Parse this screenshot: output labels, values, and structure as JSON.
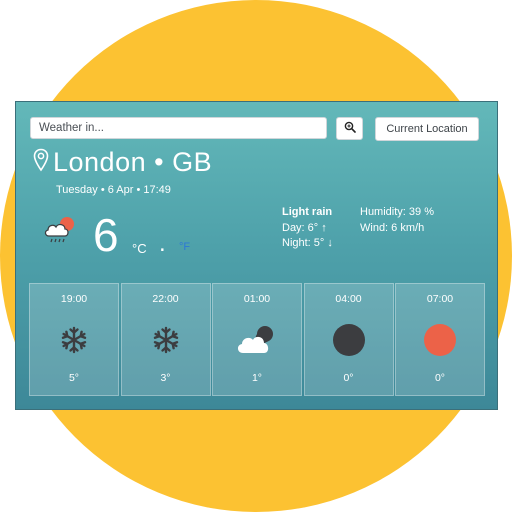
{
  "search": {
    "placeholder": "Weather in..."
  },
  "buttons": {
    "search_icon": "search-icon",
    "current_location": "Current Location"
  },
  "location": {
    "city": "London",
    "separator": "•",
    "country": "GB"
  },
  "date": "Tuesday • 6 Apr • 17:49",
  "current": {
    "temperature": "6",
    "unit_c": "°C",
    "unit_dot": ".",
    "unit_f": "°F",
    "icon": "cloud-sun-rain-icon",
    "description": "Light rain",
    "day": "Day: 6° ↑",
    "night": "Night: 5° ↓",
    "humidity": "Humidity: 39 %",
    "wind": "Wind: 6 km/h"
  },
  "forecast": [
    {
      "time": "19:00",
      "temp": "5°",
      "icon": "snowflake-icon"
    },
    {
      "time": "22:00",
      "temp": "3°",
      "icon": "snowflake-icon"
    },
    {
      "time": "01:00",
      "temp": "1°",
      "icon": "cloud-moon-icon"
    },
    {
      "time": "04:00",
      "temp": "0°",
      "icon": "moon-icon"
    },
    {
      "time": "07:00",
      "temp": "0°",
      "icon": "sun-icon"
    }
  ],
  "colors": {
    "background_circle": "#fcc232",
    "card_top": "#63b8b9",
    "card_bottom": "#3d8898",
    "moon": "#3c3d40",
    "sun": "#ec6248",
    "fahrenheit_active": "#2d78d6"
  }
}
